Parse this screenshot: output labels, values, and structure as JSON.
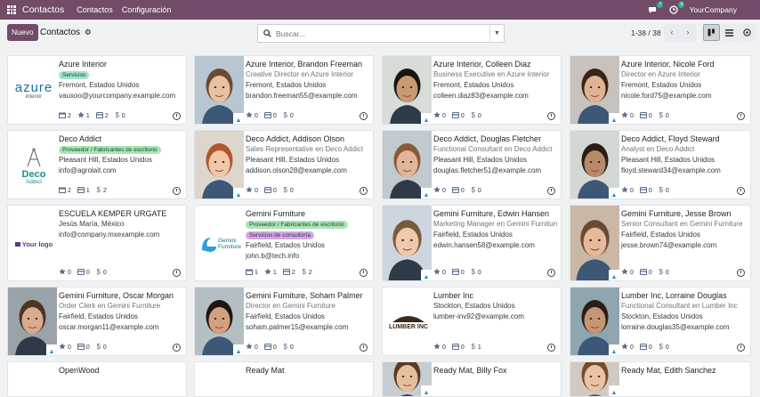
{
  "topbar": {
    "app_name": "Contactos",
    "menu": [
      "Contactos",
      "Configuración"
    ],
    "chat_badge": "7",
    "activity_badge": "9",
    "company": "YourCompany"
  },
  "control": {
    "new_label": "Nuevo",
    "breadcrumb": "Contactos",
    "search_placeholder": "Buscar...",
    "pager": "1-38 / 38",
    "prev": "‹",
    "next": "›"
  },
  "cards": [
    {
      "name": "Azure Interior",
      "tags": [
        {
          "label": "Servicios",
          "color": "teal"
        }
      ],
      "lines": [
        "Fremont, Estados Unidos",
        "vauxoo@yourcompany.example.com"
      ],
      "stats": [
        [
          "meeting",
          "2"
        ],
        [
          "star",
          "1"
        ],
        [
          "money",
          "2"
        ],
        [
          "dollar",
          "0"
        ]
      ]
    },
    {
      "name": "Azure Interior, Brandon Freeman",
      "function": "Creative Director en Azure Interior",
      "lines": [
        "Fremont, Estados Unidos",
        "brandon.freeman55@example.com"
      ],
      "stats": [
        [
          "star",
          "0"
        ],
        [
          "money",
          "0"
        ],
        [
          "dollar",
          "0"
        ]
      ]
    },
    {
      "name": "Azure Interior, Colleen Diaz",
      "function": "Business Executive en Azure Interior",
      "lines": [
        "Fremont, Estados Unidos",
        "colleen.diaz83@example.com"
      ],
      "stats": [
        [
          "star",
          "0"
        ],
        [
          "money",
          "0"
        ],
        [
          "dollar",
          "0"
        ]
      ]
    },
    {
      "name": "Azure Interior, Nicole Ford",
      "function": "Director en Azure Interior",
      "lines": [
        "Fremont, Estados Unidos",
        "nicole.ford75@example.com"
      ],
      "stats": [
        [
          "star",
          "0"
        ],
        [
          "money",
          "0"
        ],
        [
          "dollar",
          "0"
        ]
      ]
    },
    {
      "name": "Deco Addict",
      "tags": [
        {
          "label": "Proveedor / Fabricantes de escritorio",
          "color": "green"
        }
      ],
      "lines": [
        "Pleasant Hill, Estados Unidos",
        "info@agrolait.com"
      ],
      "stats": [
        [
          "meeting",
          "2"
        ],
        [
          "money",
          "1"
        ],
        [
          "dollar",
          "2"
        ]
      ]
    },
    {
      "name": "Deco Addict, Addison Olson",
      "function": "Sales Representative en Deco Addict",
      "lines": [
        "Pleasant Hill, Estados Unidos",
        "addison.olson28@example.com"
      ],
      "stats": [
        [
          "star",
          "0"
        ],
        [
          "money",
          "0"
        ],
        [
          "dollar",
          "0"
        ]
      ]
    },
    {
      "name": "Deco Addict, Douglas Fletcher",
      "function": "Functional Consultant en Deco Addict",
      "lines": [
        "Pleasant Hill, Estados Unidos",
        "douglas.fletcher51@example.com"
      ],
      "stats": [
        [
          "star",
          "0"
        ],
        [
          "money",
          "0"
        ],
        [
          "dollar",
          "0"
        ]
      ]
    },
    {
      "name": "Deco Addict, Floyd Steward",
      "function": "Analyst en Deco Addict",
      "lines": [
        "Pleasant Hill, Estados Unidos",
        "floyd.steward34@example.com"
      ],
      "stats": [
        [
          "star",
          "0"
        ],
        [
          "money",
          "0"
        ],
        [
          "dollar",
          "0"
        ]
      ]
    },
    {
      "name": "ESCUELA KEMPER URGATE",
      "lines": [
        "Jesús María, México",
        "info@company.mxexample.com"
      ],
      "stats": [
        [
          "star",
          "0"
        ],
        [
          "money",
          "0"
        ],
        [
          "dollar",
          "0"
        ]
      ]
    },
    {
      "name": "Gemini Furniture",
      "tags": [
        {
          "label": "Proveedor / Fabricantes de escritorio",
          "color": "green"
        },
        {
          "label": "Servicios de consultoría",
          "color": "purple"
        }
      ],
      "lines": [
        "Fairfield, Estados Unidos",
        "john.b@tech.info"
      ],
      "stats": [
        [
          "meeting",
          "1"
        ],
        [
          "star",
          "1"
        ],
        [
          "money",
          "2"
        ],
        [
          "dollar",
          "2"
        ]
      ]
    },
    {
      "name": "Gemini Furniture, Edwin Hansen",
      "function": "Marketing Manager en Gemini Furniture",
      "lines": [
        "Fairfield, Estados Unidos",
        "edwin.hansen58@example.com"
      ],
      "stats": [
        [
          "star",
          "0"
        ],
        [
          "money",
          "0"
        ],
        [
          "dollar",
          "0"
        ]
      ]
    },
    {
      "name": "Gemini Furniture, Jesse Brown",
      "function": "Senior Consultant en Gemini Furniture",
      "lines": [
        "Fairfield, Estados Unidos",
        "jesse.brown74@example.com"
      ],
      "stats": [
        [
          "star",
          "0"
        ],
        [
          "money",
          "0"
        ],
        [
          "dollar",
          "0"
        ]
      ]
    },
    {
      "name": "Gemini Furniture, Oscar Morgan",
      "function": "Order Clerk en Gemini Furniture",
      "lines": [
        "Fairfield, Estados Unidos",
        "oscar.morgan11@example.com"
      ],
      "stats": [
        [
          "star",
          "0"
        ],
        [
          "money",
          "0"
        ],
        [
          "dollar",
          "0"
        ]
      ]
    },
    {
      "name": "Gemini Furniture, Soham Palmer",
      "function": "Director en Gemini Furniture",
      "lines": [
        "Fairfield, Estados Unidos",
        "soham.palmer15@example.com"
      ],
      "stats": [
        [
          "star",
          "0"
        ],
        [
          "money",
          "0"
        ],
        [
          "dollar",
          "0"
        ]
      ]
    },
    {
      "name": "Lumber Inc",
      "lines": [
        "Stockton, Estados Unidos",
        "lumber-inv92@example.com"
      ],
      "stats": [
        [
          "star",
          "0"
        ],
        [
          "money",
          "0"
        ],
        [
          "dollar",
          "1"
        ]
      ]
    },
    {
      "name": "Lumber Inc, Lorraine Douglas",
      "function": "Functional Consultant en Lumber Inc",
      "lines": [
        "Stockton, Estados Unidos",
        "lorraine.douglas35@example.com"
      ],
      "stats": [
        [
          "star",
          "0"
        ],
        [
          "money",
          "0"
        ],
        [
          "dollar",
          "0"
        ]
      ]
    },
    {
      "name": "OpenWood",
      "lines": [],
      "stats": []
    },
    {
      "name": "Ready Mat",
      "lines": [],
      "stats": []
    },
    {
      "name": "Ready Mat, Billy Fox",
      "lines": [],
      "stats": []
    },
    {
      "name": "Ready Mat, Edith Sanchez",
      "lines": [],
      "stats": []
    }
  ],
  "logos": {
    "azure": "azure",
    "azure_sub": "interior",
    "deco": "Deco",
    "deco_sub": "Addict",
    "yourlogo": "Your logo",
    "gemini": "Gemini",
    "gemini_sub": "Furniture",
    "lumber": "LUMBER INC"
  },
  "colors": {
    "brand": "#714b67",
    "badge": "#21b799",
    "stat_icon": "#5a6e90"
  }
}
